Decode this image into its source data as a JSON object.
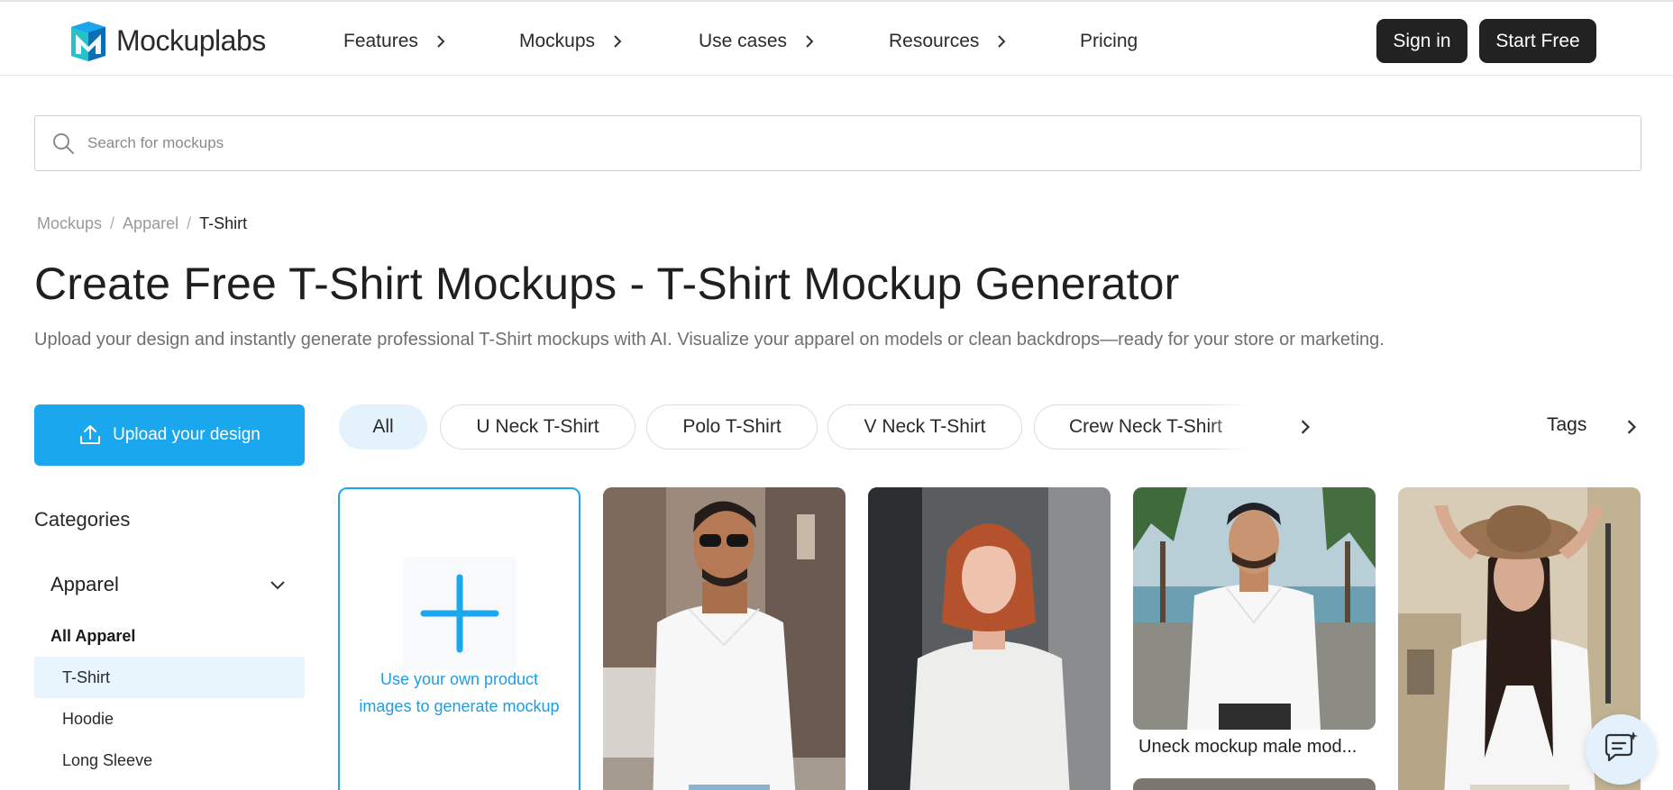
{
  "brand": {
    "name": "Mockuplabs",
    "logo_colors": [
      "#1aa7ee",
      "#0d6fb3",
      "#24c2c9"
    ]
  },
  "nav": {
    "items": [
      {
        "label": "Features",
        "has_submenu": true
      },
      {
        "label": "Mockups",
        "has_submenu": true
      },
      {
        "label": "Use cases",
        "has_submenu": true
      },
      {
        "label": "Resources",
        "has_submenu": true
      },
      {
        "label": "Pricing",
        "has_submenu": false
      }
    ],
    "sign_in": "Sign in",
    "start_free": "Start Free"
  },
  "search": {
    "placeholder": "Search for mockups",
    "value": "",
    "icon": "search-icon"
  },
  "breadcrumb": [
    "Mockups",
    "Apparel",
    "T-Shirt"
  ],
  "page": {
    "title": "Create Free T-Shirt Mockups - T-Shirt Mockup Generator",
    "subtitle": "Upload your design and instantly generate professional T-Shirt mockups with AI. Visualize your apparel on models or clean backdrops—ready for your store or marketing."
  },
  "upload": {
    "label": "Upload your design",
    "icon": "upload-icon",
    "color": "#1aa7ee"
  },
  "sidebar": {
    "title": "Categories",
    "group": "Apparel",
    "all_label": "All Apparel",
    "items": [
      {
        "label": "T-Shirt",
        "active": true
      },
      {
        "label": "Hoodie",
        "active": false
      },
      {
        "label": "Long Sleeve",
        "active": false
      }
    ]
  },
  "filters": {
    "pills": [
      {
        "label": "All",
        "active": true
      },
      {
        "label": "U Neck T-Shirt",
        "active": false
      },
      {
        "label": "Polo T-Shirt",
        "active": false
      },
      {
        "label": "V Neck T-Shirt",
        "active": false
      },
      {
        "label": "Crew Neck T-Shirt",
        "active": false
      }
    ],
    "tags_label": "Tags"
  },
  "grid": {
    "own_card_text": "Use your own product images to generate mockup",
    "cards": [
      {
        "subject": "man-sunglasses-street",
        "caption": ""
      },
      {
        "subject": "woman-red-hair-wall",
        "caption": ""
      },
      {
        "subject": "man-cap-beach",
        "caption": "Uneck mockup male mod..."
      },
      {
        "subject": "woman-hat-street",
        "caption": ""
      }
    ]
  },
  "chat": {
    "icon": "chat-support-icon"
  }
}
